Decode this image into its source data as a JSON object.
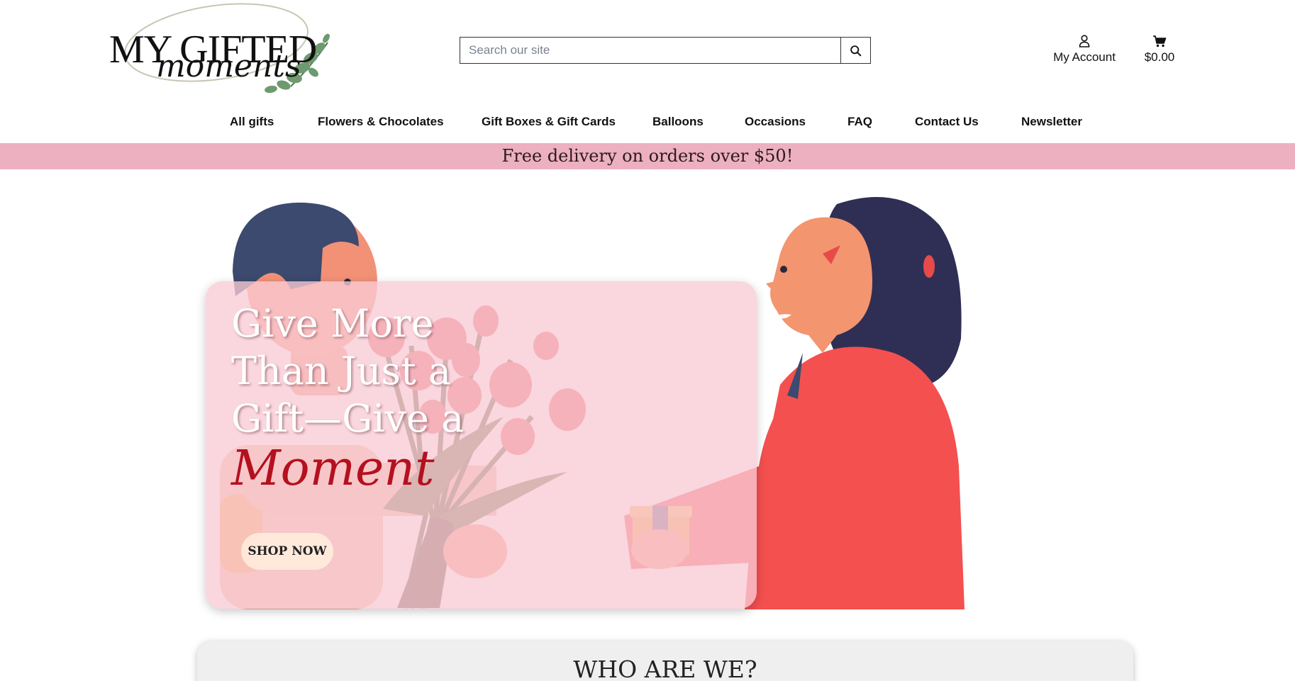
{
  "header": {
    "logo": {
      "title": "MY GIFTED",
      "script": "moments"
    },
    "search": {
      "placeholder": "Search our site",
      "icon": "search-icon"
    },
    "account": {
      "label": "My Account",
      "icon": "user-icon"
    },
    "cart": {
      "label": "$0.00",
      "icon": "cart-icon"
    }
  },
  "nav": {
    "items": [
      {
        "label": "All gifts"
      },
      {
        "label": "Flowers & Chocolates"
      },
      {
        "label": "Gift Boxes & Gift Cards"
      },
      {
        "label": "Balloons"
      },
      {
        "label": "Occasions"
      },
      {
        "label": "FAQ"
      },
      {
        "label": "Contact Us"
      },
      {
        "label": "Newsletter"
      }
    ]
  },
  "promo": {
    "text": "Free delivery on orders over $50!",
    "color": "#ecb0c0"
  },
  "hero": {
    "headline_lines": [
      "Give More",
      "Than Just a",
      "Gift—Give a"
    ],
    "script_word": "Moment",
    "cta": "SHOP NOW"
  },
  "about": {
    "title": "WHO ARE WE?"
  }
}
